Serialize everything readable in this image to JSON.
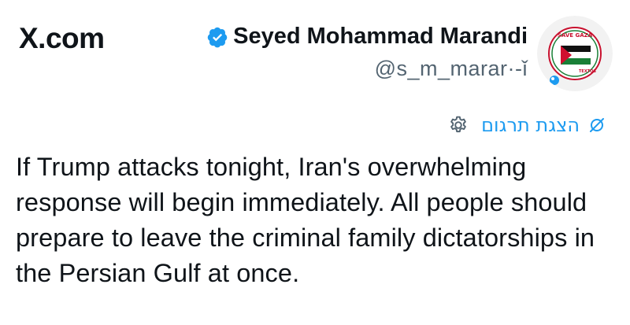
{
  "brand": {
    "site_name": "X.com"
  },
  "author": {
    "display_name": "Seyed Mohammad Marandi",
    "handle": "@s_m_marar·-ǐ",
    "verified": true,
    "avatar_text_top": "SAVE GAZA",
    "avatar_text_side": "TEXTOS"
  },
  "translation": {
    "label": "הצגת תרגום"
  },
  "tweet": {
    "text": "If Trump attacks tonight, Iran's overwhelming response will begin immediately. All people should prepare to leave the criminal family dictatorships in the Persian Gulf at once."
  },
  "colors": {
    "accent": "#1d9bf0",
    "text": "#0f1419",
    "muted": "#536471"
  }
}
